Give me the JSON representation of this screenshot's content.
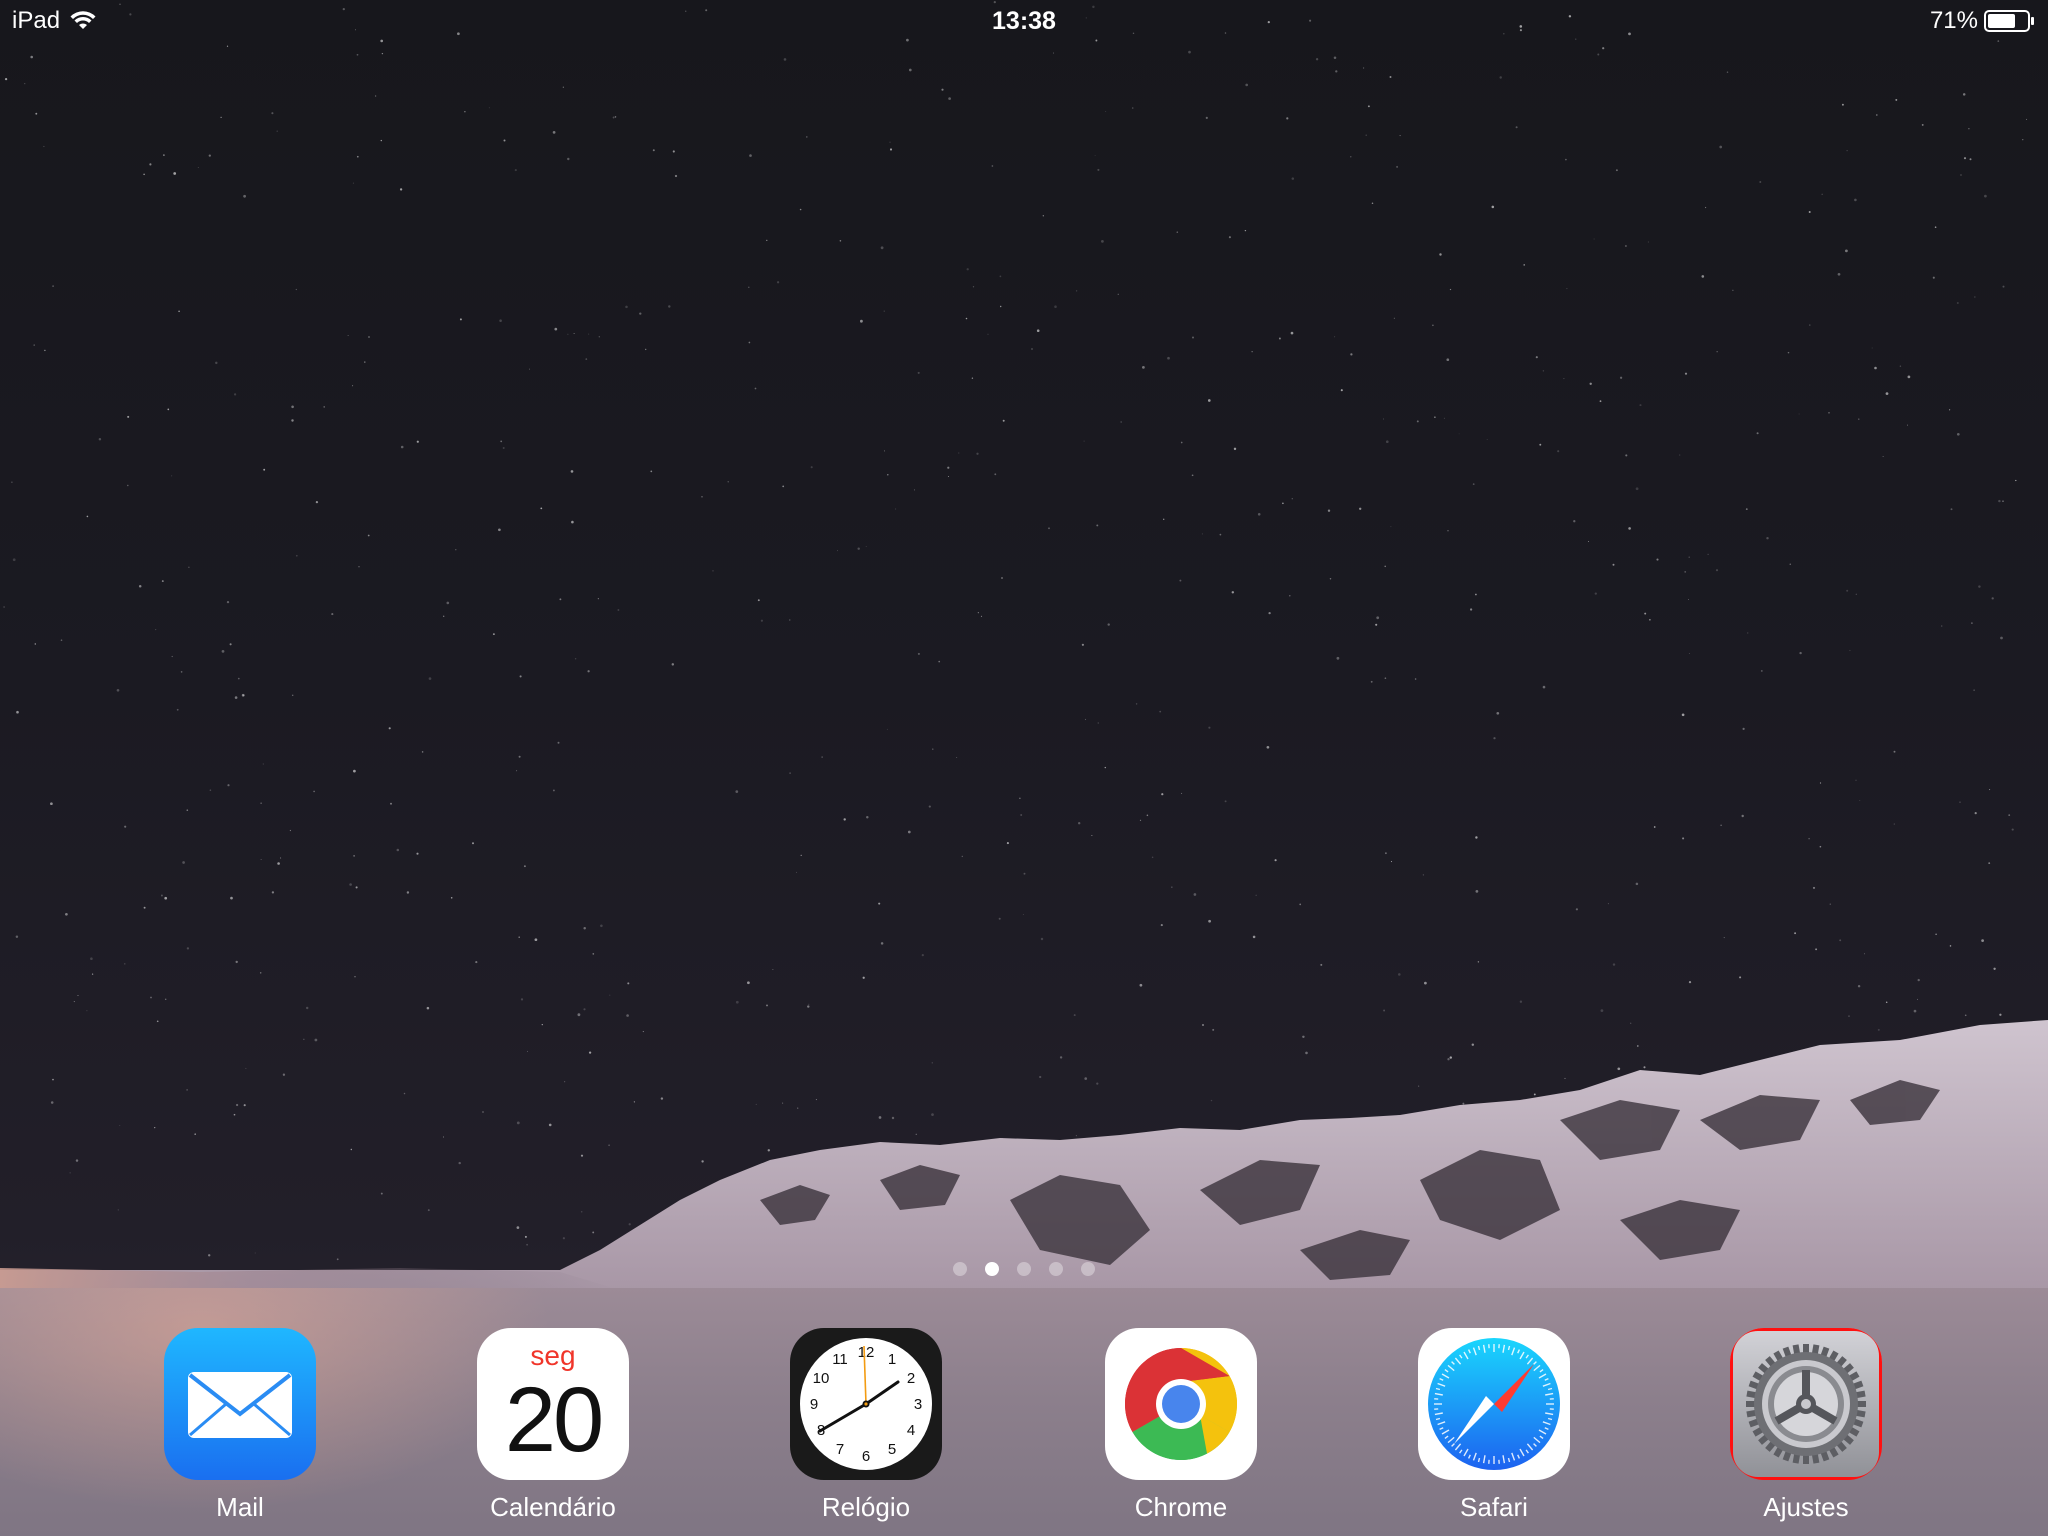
{
  "status_bar": {
    "carrier": "iPad",
    "time": "13:38",
    "battery_percent": "71%",
    "battery_level": 0.71,
    "wifi_icon": "wifi-icon",
    "battery_icon": "battery-icon"
  },
  "page_indicator": {
    "count": 5,
    "active_index": 1
  },
  "dock": {
    "apps": [
      {
        "label": "Mail",
        "icon": "mail-icon"
      },
      {
        "label": "Calendário",
        "icon": "calendar-icon",
        "weekday": "seg",
        "day": "20"
      },
      {
        "label": "Relógio",
        "icon": "clock-icon",
        "numerals": [
          "12",
          "1",
          "2",
          "3",
          "4",
          "5",
          "6",
          "7",
          "8",
          "9",
          "10",
          "11"
        ]
      },
      {
        "label": "Chrome",
        "icon": "chrome-icon"
      },
      {
        "label": "Safari",
        "icon": "safari-icon"
      },
      {
        "label": "Ajustes",
        "icon": "settings-icon"
      }
    ]
  },
  "colors": {
    "highlight": "#ff1010",
    "calendar_weekday": "#f0352a",
    "mail_top": "#1fb7ff",
    "mail_bottom": "#1a6ff0"
  }
}
